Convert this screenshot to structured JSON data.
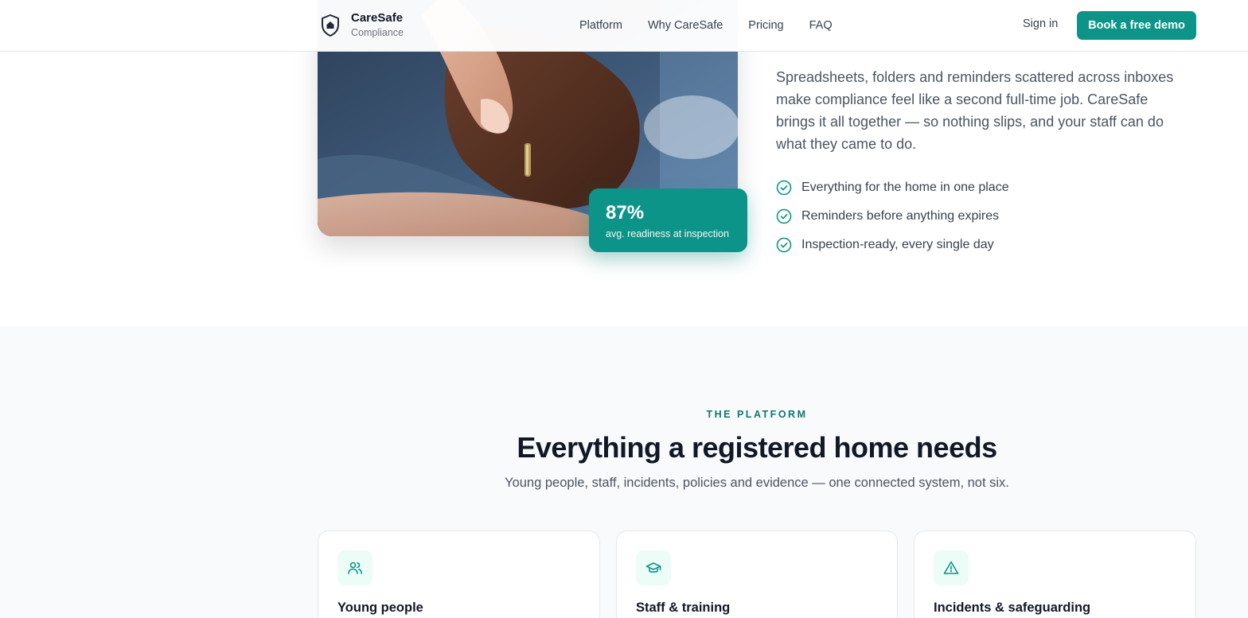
{
  "header": {
    "brand_name": "CareSafe",
    "brand_sub": "Compliance",
    "nav": [
      "Platform",
      "Why CareSafe",
      "Pricing",
      "FAQ"
    ],
    "sign_in": "Sign in",
    "cta": "Book a free demo"
  },
  "hero": {
    "stat_value": "87%",
    "stat_label": "avg. readiness at inspection",
    "body": "Spreadsheets, folders and reminders scattered across inboxes make compliance feel like a second full-time job. CareSafe brings it all together — so nothing slips, and your staff can do what they came to do.",
    "checklist": [
      "Everything for the home in one place",
      "Reminders before anything expires",
      "Inspection-ready, every single day"
    ]
  },
  "platform": {
    "eyebrow": "THE PLATFORM",
    "title": "Everything a registered home needs",
    "subtitle": "Young people, staff, incidents, policies and evidence — one connected system, not six.",
    "cards": [
      {
        "title": "Young people",
        "icon": "users-icon"
      },
      {
        "title": "Staff & training",
        "icon": "graduation-cap-icon"
      },
      {
        "title": "Incidents & safeguarding",
        "icon": "warning-icon"
      }
    ]
  },
  "colors": {
    "accent": "#0d9488",
    "heading": "#111827",
    "muted": "#4b5563",
    "section_bg": "#f8fafc"
  }
}
